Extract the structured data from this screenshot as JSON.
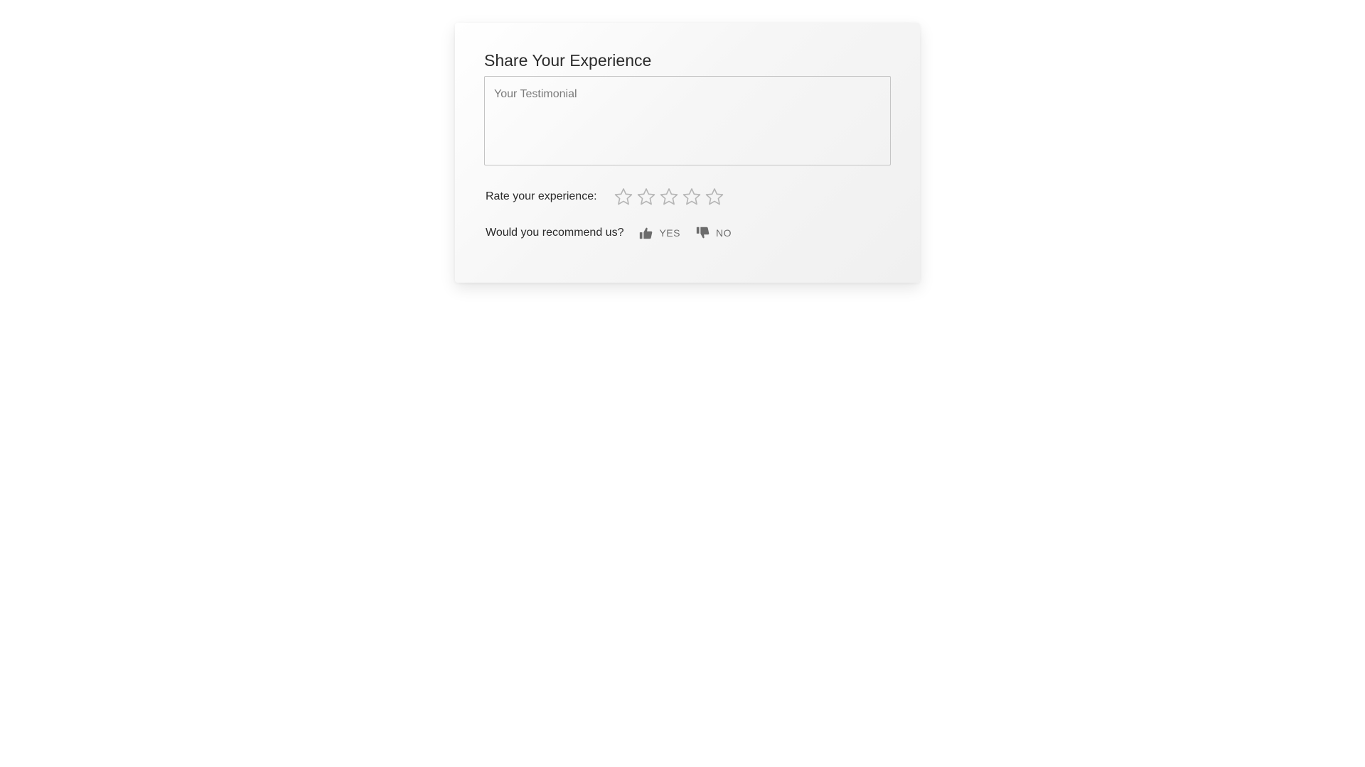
{
  "form": {
    "title": "Share Your Experience",
    "testimonial_placeholder": "Your Testimonial",
    "rating_label": "Rate your experience:",
    "rating_max": 5,
    "rating_value": 0,
    "recommend_label": "Would you recommend us?",
    "yes_label": "YES",
    "no_label": "NO"
  },
  "icons": {
    "star": "star-outline-icon",
    "yes": "thumbs-up-icon",
    "no": "thumbs-down-icon"
  },
  "colors": {
    "star_outline": "#b5b5b5",
    "thumb_icon": "#6b6b6b",
    "text": "#2b2b2b"
  }
}
